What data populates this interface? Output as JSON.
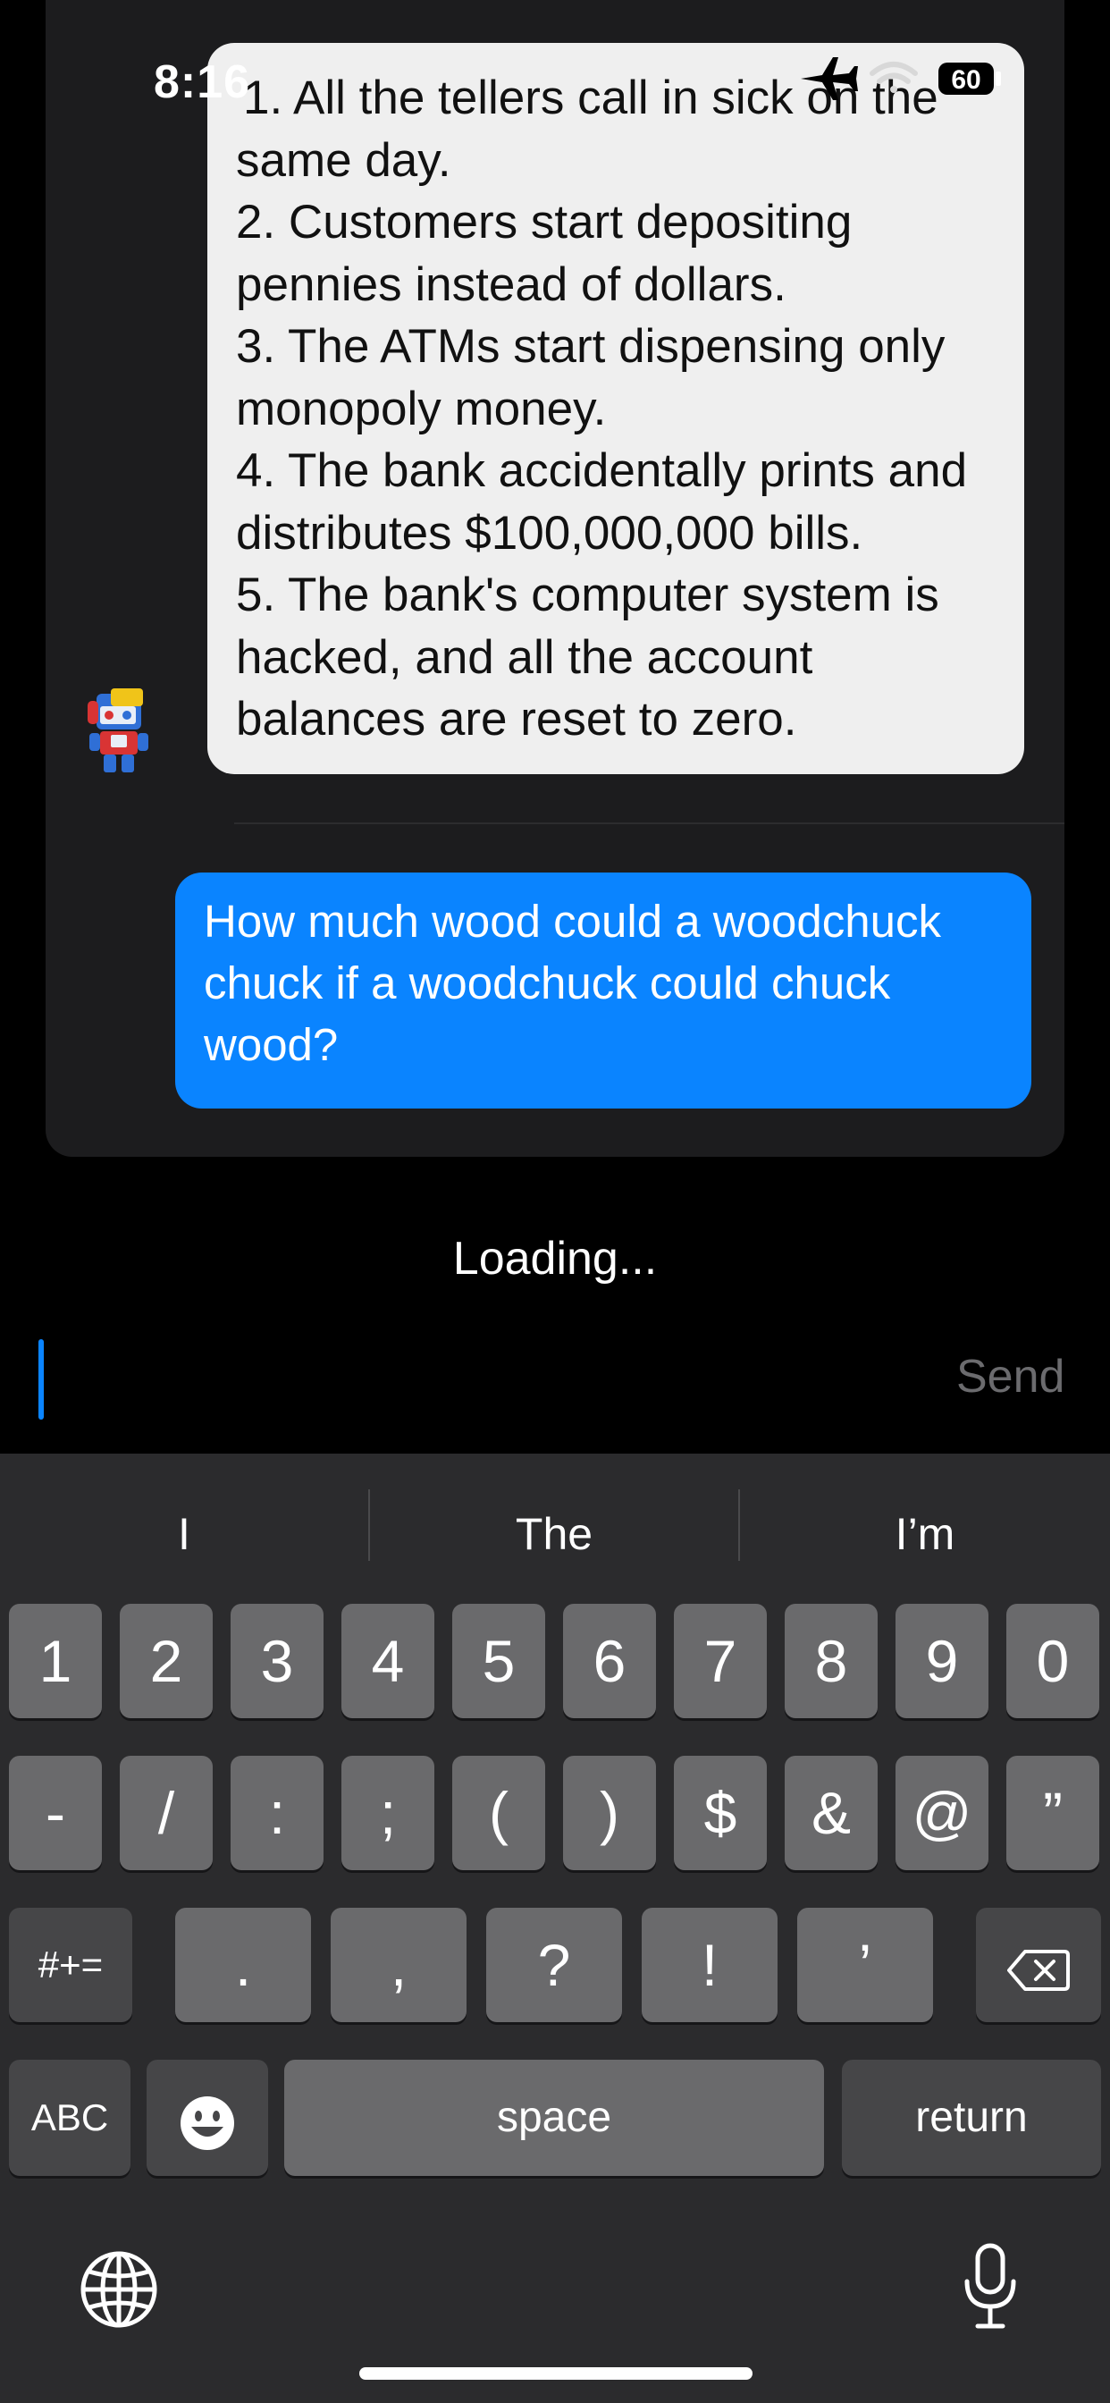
{
  "status_bar": {
    "time": "8:16",
    "battery": "60",
    "icons": [
      "airplane-icon",
      "wifi-icon",
      "battery-icon"
    ]
  },
  "chat": {
    "bot_message_lines": [
      "1. All the tellers call in sick on the",
      "same day.",
      "2. Customers start depositing",
      "pennies instead of dollars.",
      "3. The ATMs start dispensing only",
      "monopoly money.",
      "4. The bank accidentally prints and",
      "distributes $100,000,000 bills.",
      "5. The bank's computer system is",
      "hacked, and all the account",
      "balances are reset to zero."
    ],
    "user_message_lines": [
      "How much wood could a woodchuck",
      "chuck if a woodchuck could chuck",
      "wood?"
    ]
  },
  "loading_text": "Loading...",
  "composer": {
    "value": "",
    "send_label": "Send"
  },
  "keyboard": {
    "suggestions": [
      "I",
      "The",
      "I’m"
    ],
    "row1": [
      "1",
      "2",
      "3",
      "4",
      "5",
      "6",
      "7",
      "8",
      "9",
      "0"
    ],
    "row2": [
      "-",
      "/",
      ":",
      ";",
      "(",
      ")",
      "$",
      "&",
      "@",
      "”"
    ],
    "row3": [
      "#+=",
      ".",
      ",",
      "?",
      "!",
      "’"
    ],
    "row4": [
      "ABC",
      "space",
      "return"
    ]
  },
  "colors": {
    "accent": "#0a84ff",
    "bot_bubble": "#efefef",
    "panel": "#1c1c1e",
    "keyboard_bg": "#2b2b2d"
  }
}
